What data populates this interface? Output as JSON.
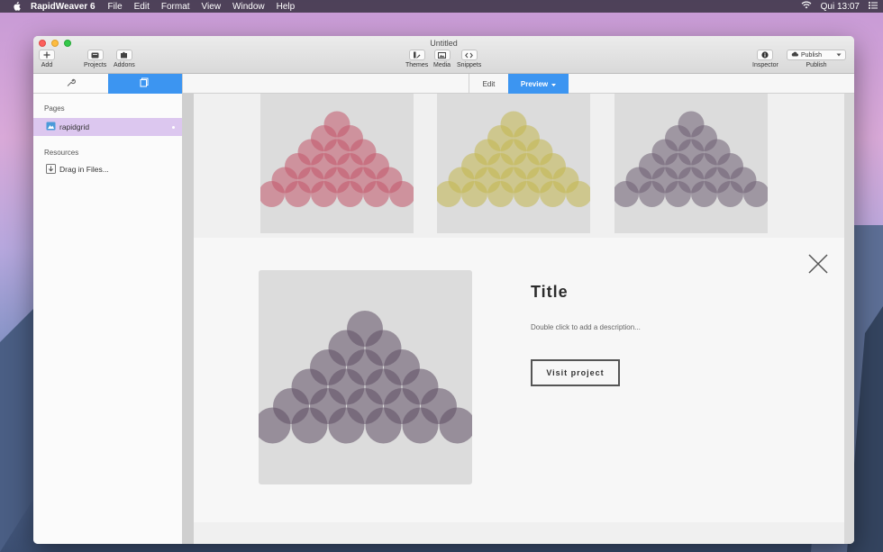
{
  "menubar": {
    "app_name": "RapidWeaver 6",
    "items": [
      "File",
      "Edit",
      "Format",
      "View",
      "Window",
      "Help"
    ],
    "clock": "Qui 13:07"
  },
  "window": {
    "title": "Untitled"
  },
  "toolbar": {
    "add_label": "Add",
    "projects_label": "Projects",
    "addons_label": "Addons",
    "themes_label": "Themes",
    "media_label": "Media",
    "snippets_label": "Snippets",
    "inspector_label": "Inspector",
    "publish_button_label": "Publish",
    "publish_label": "Publish"
  },
  "sidebar": {
    "pages_heading": "Pages",
    "page_item": "rapidgrid",
    "resources_heading": "Resources",
    "resource_item": "Drag in Files..."
  },
  "modes": {
    "edit": "Edit",
    "preview": "Preview"
  },
  "thumbnails": [
    {
      "color": "#c2566a"
    },
    {
      "color": "#c3b64f"
    },
    {
      "color": "#6d5f73"
    }
  ],
  "detail": {
    "title": "Title",
    "description": "Double click to add a description...",
    "button": "Visit project",
    "color": "#5f4f64"
  }
}
